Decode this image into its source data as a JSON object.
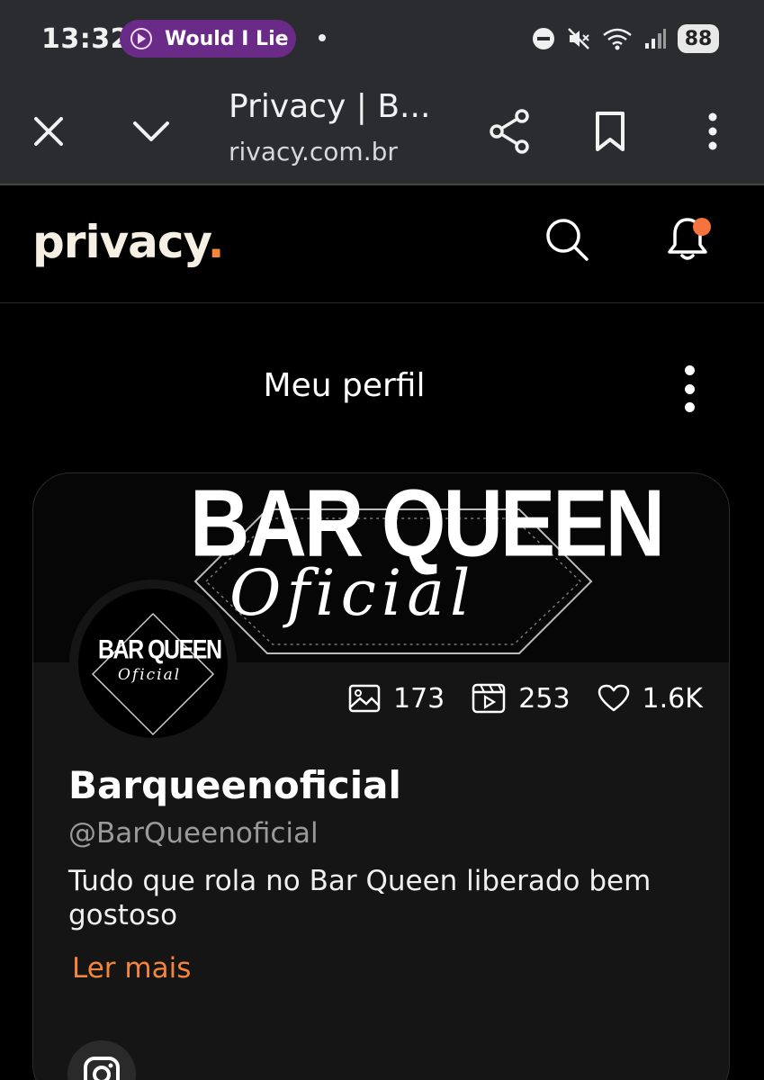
{
  "status_bar": {
    "time": "13:32",
    "media_label": "Would I Lie",
    "battery": "88"
  },
  "browser": {
    "tab_title": "Privacy | B...",
    "url": "rivacy.com.br"
  },
  "site": {
    "logo_text": "privacy",
    "logo_dot": ".",
    "accent_color": "#f5853a"
  },
  "page": {
    "title": "Meu perfil"
  },
  "profile": {
    "banner_title": "BAR QUEEN",
    "banner_script": "Oficial",
    "avatar_title": "BAR QUEEN",
    "avatar_script": "Oficial",
    "stats": {
      "photos": "173",
      "videos": "253",
      "likes": "1.6K"
    },
    "name": "Barqueenoficial",
    "handle": "@BarQueenoficial",
    "bio": "Tudo que rola no Bar Queen liberado bem gostoso",
    "read_more": "Ler mais"
  },
  "icons": {
    "close": "close-icon",
    "minimize": "chevron-down-icon",
    "share": "share-icon",
    "bookmark": "bookmark-icon",
    "menu": "kebab-menu-icon",
    "search": "search-icon",
    "notifications": "bell-icon",
    "photos": "image-icon",
    "videos": "video-icon",
    "likes": "heart-icon",
    "instagram": "instagram-icon"
  }
}
